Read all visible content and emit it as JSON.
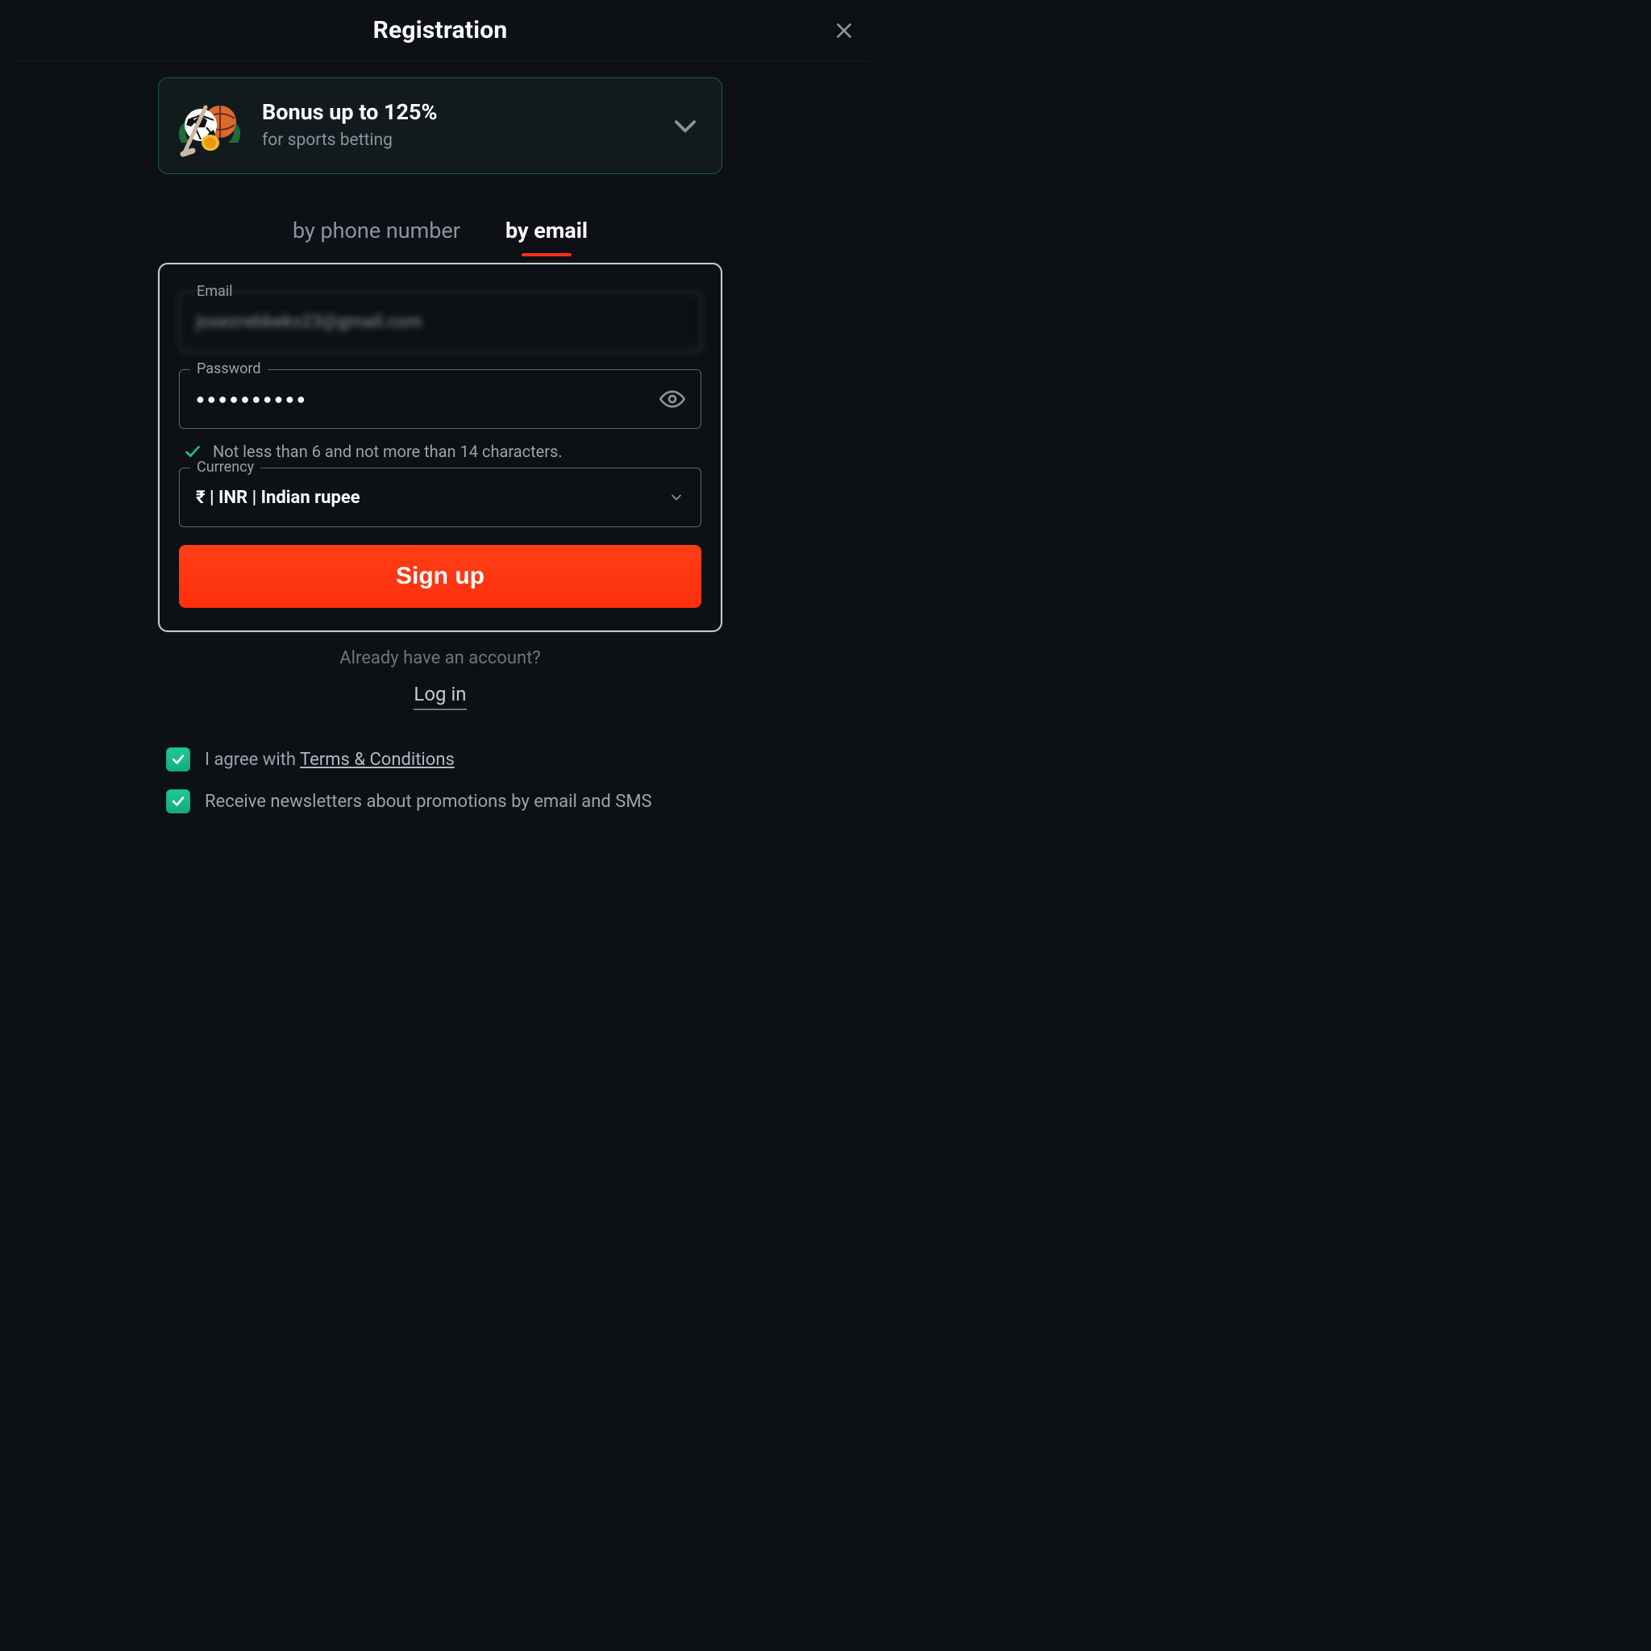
{
  "header": {
    "title": "Registration"
  },
  "bonus": {
    "title": "Bonus up to 125%",
    "subtitle": "for sports betting"
  },
  "tabs": {
    "phone_label": "by phone number",
    "email_label": "by email",
    "active": "email"
  },
  "form": {
    "email": {
      "label": "Email",
      "value": "josezrebbeks23@gmail.com"
    },
    "password": {
      "label": "Password",
      "value_masked": "●●●●●●●●●●",
      "hint": "Not less than 6 and not more than 14 characters."
    },
    "currency": {
      "label": "Currency",
      "value": "₹ | INR | Indian rupee"
    },
    "signup_label": "Sign up"
  },
  "footer": {
    "already": "Already have an account?",
    "login": "Log in"
  },
  "checkboxes": {
    "terms_prefix": "I agree with ",
    "terms_link": "Terms & Conditions",
    "terms_checked": true,
    "newsletter": "Receive newsletters about promotions by email and SMS",
    "newsletter_checked": true
  }
}
